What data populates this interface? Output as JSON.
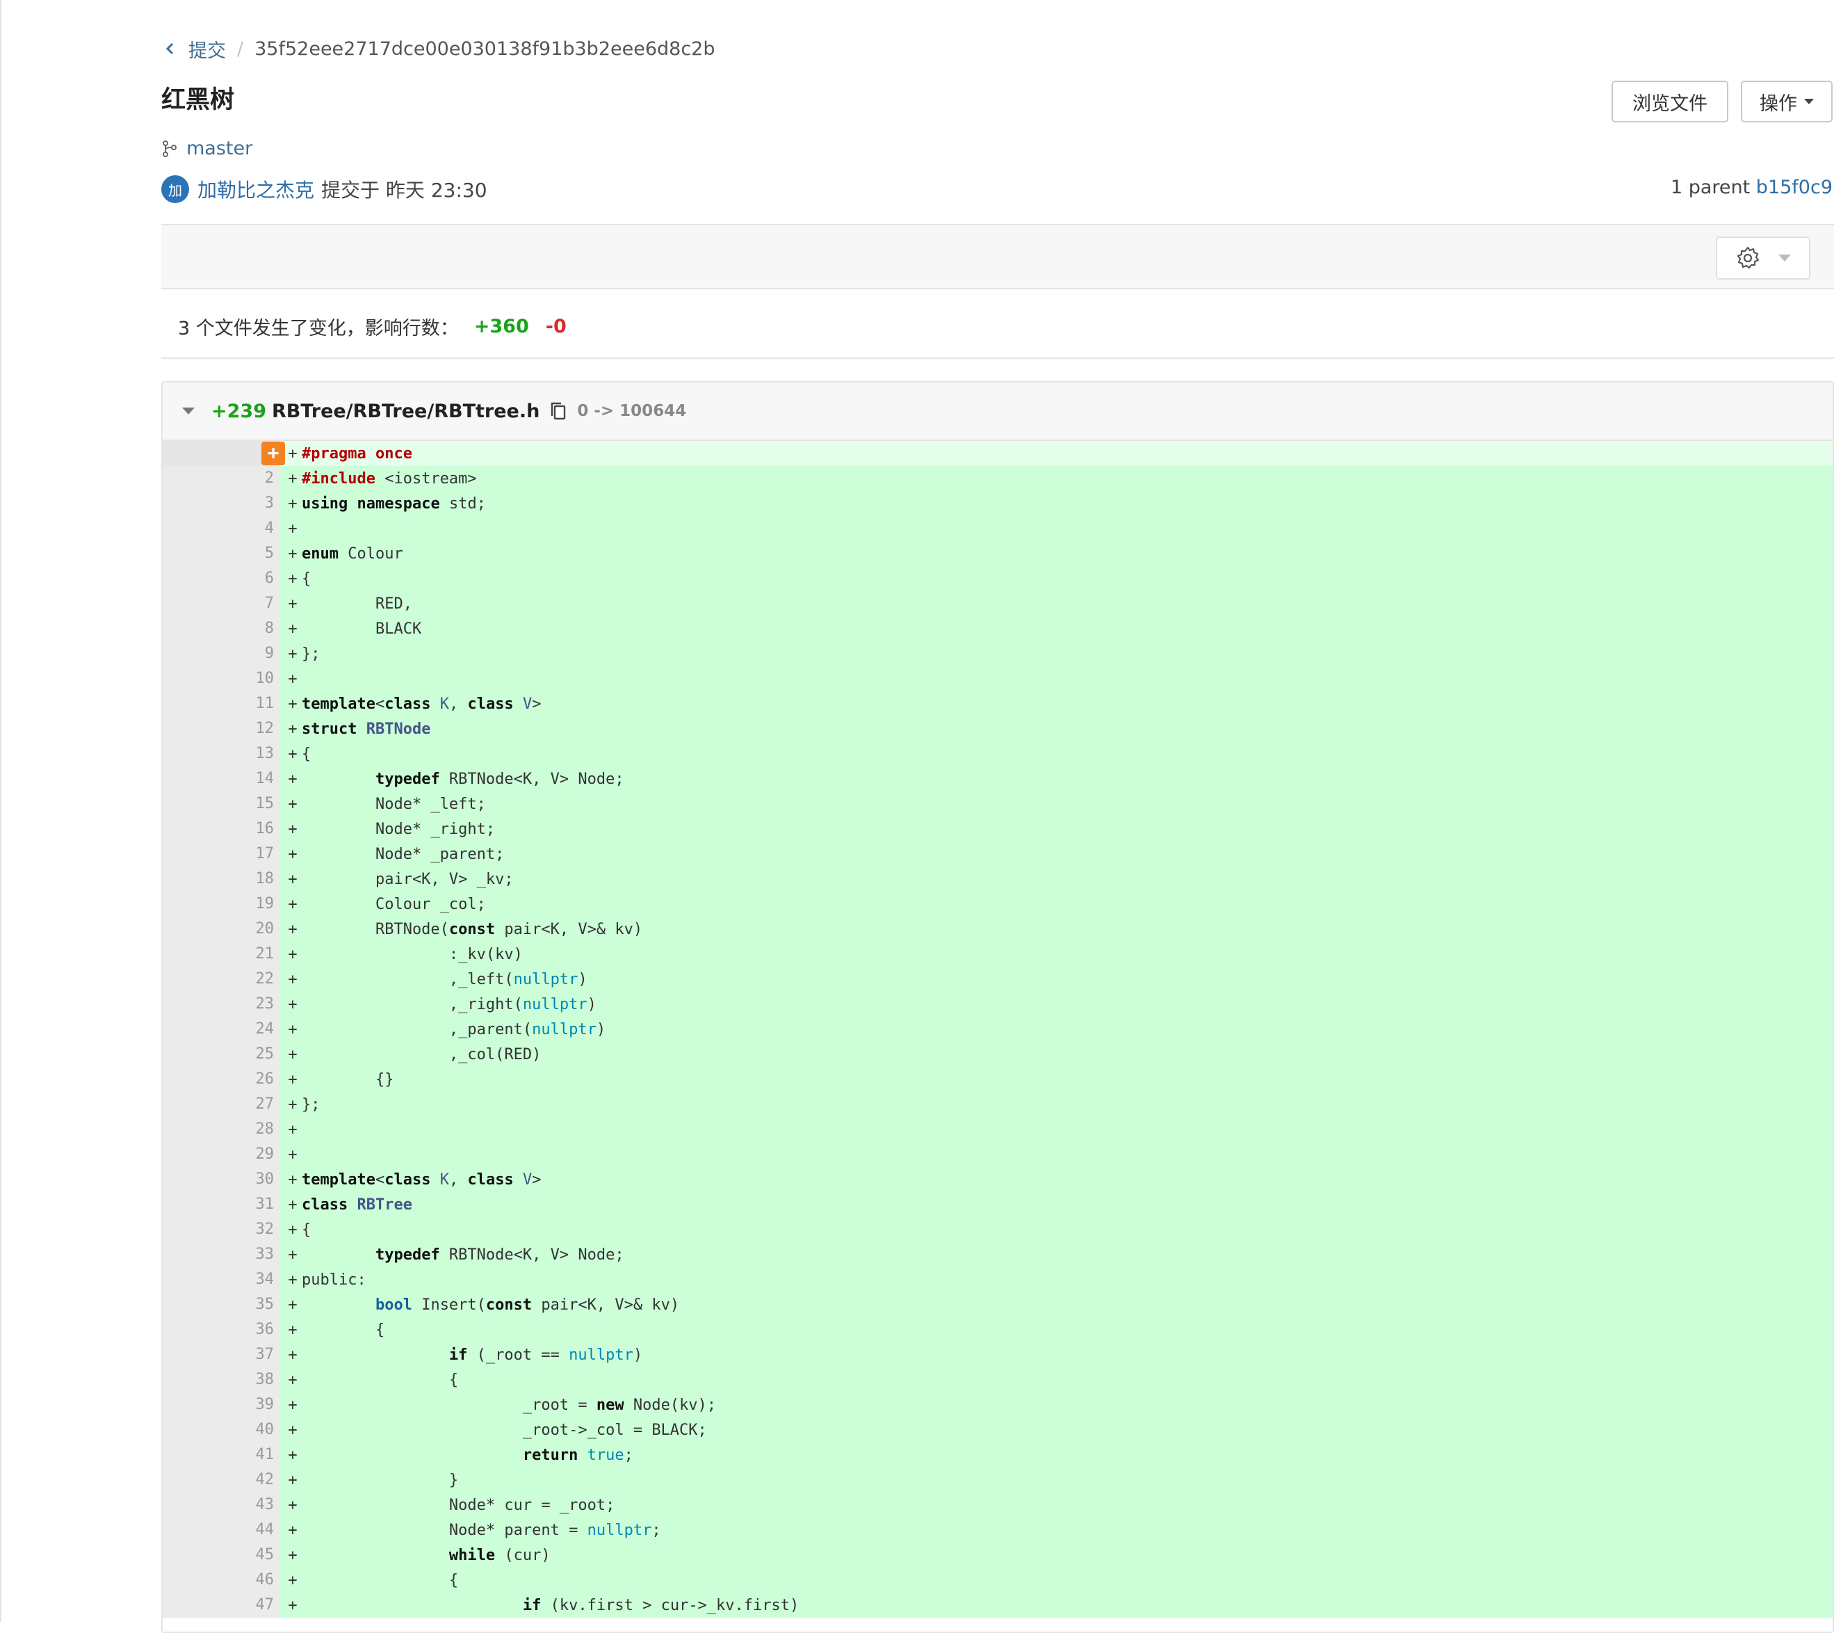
{
  "breadcrumb": {
    "back_label": "提交",
    "separator": "/",
    "commit_hash": "35f52eee2717dce00e030138f91b3b2eee6d8c2b"
  },
  "commit": {
    "title": "红黑树",
    "branch": "master",
    "author_avatar": "加",
    "author": "加勒比之杰克",
    "committed_text": "提交于 昨天 23:30",
    "parent_label": "1 parent",
    "parent_hash": "b15f0c9"
  },
  "actions": {
    "browse_label": "浏览文件",
    "ops_label": "操作"
  },
  "stats": {
    "summary": "3 个文件发生了变化，影响行数：",
    "additions": "+360",
    "deletions": "-0"
  },
  "file": {
    "additions": "+239",
    "path": "RBTree/RBTree/RBTtree.h",
    "mode_change": "0 -> 100644"
  },
  "icons": {
    "back": "chevron-left-icon",
    "branch": "branch-icon",
    "copy": "copy-icon",
    "settings": "gear-icon",
    "add_comment": "plus-icon"
  },
  "colors": {
    "added_bg": "#ccffd8",
    "added_count": "#1aa31a",
    "deleted_count": "#d62b2b",
    "link": "#2e6ea6",
    "comment_button": "#f58220"
  },
  "lines": [
    {
      "n": "1",
      "code": [
        {
          "t": "#pragma once",
          "c": "kw-red"
        }
      ]
    },
    {
      "n": "2",
      "code": [
        {
          "t": "#include",
          "c": "kw-red"
        },
        {
          "t": " <iostream>"
        }
      ]
    },
    {
      "n": "3",
      "code": [
        {
          "t": "using",
          "c": "kw"
        },
        {
          "t": " "
        },
        {
          "t": "namespace",
          "c": "kw"
        },
        {
          "t": " std;"
        }
      ]
    },
    {
      "n": "4",
      "code": []
    },
    {
      "n": "5",
      "code": [
        {
          "t": "enum",
          "c": "kw"
        },
        {
          "t": " Colour"
        }
      ]
    },
    {
      "n": "6",
      "code": [
        {
          "t": "{"
        }
      ]
    },
    {
      "n": "7",
      "code": [
        {
          "t": "        RED,"
        }
      ]
    },
    {
      "n": "8",
      "code": [
        {
          "t": "        BLACK"
        }
      ]
    },
    {
      "n": "9",
      "code": [
        {
          "t": "};"
        }
      ]
    },
    {
      "n": "10",
      "code": []
    },
    {
      "n": "11",
      "code": [
        {
          "t": "template",
          "c": "kw"
        },
        {
          "t": "<"
        },
        {
          "t": "class",
          "c": "kw"
        },
        {
          "t": " "
        },
        {
          "t": "K",
          "c": "tpl"
        },
        {
          "t": ", "
        },
        {
          "t": "class",
          "c": "kw"
        },
        {
          "t": " "
        },
        {
          "t": "V",
          "c": "tpl"
        },
        {
          "t": ">"
        }
      ]
    },
    {
      "n": "12",
      "code": [
        {
          "t": "struct",
          "c": "kw"
        },
        {
          "t": " "
        },
        {
          "t": "RBTNode",
          "c": "ty"
        }
      ]
    },
    {
      "n": "13",
      "code": [
        {
          "t": "{"
        }
      ]
    },
    {
      "n": "14",
      "code": [
        {
          "t": "        "
        },
        {
          "t": "typedef",
          "c": "kw"
        },
        {
          "t": " RBTNode<K, V> Node;"
        }
      ]
    },
    {
      "n": "15",
      "code": [
        {
          "t": "        Node* _left;"
        }
      ]
    },
    {
      "n": "16",
      "code": [
        {
          "t": "        Node* _right;"
        }
      ]
    },
    {
      "n": "17",
      "code": [
        {
          "t": "        Node* _parent;"
        }
      ]
    },
    {
      "n": "18",
      "code": [
        {
          "t": "        pair<K, V> _kv;"
        }
      ]
    },
    {
      "n": "19",
      "code": [
        {
          "t": "        Colour _col;"
        }
      ]
    },
    {
      "n": "20",
      "code": [
        {
          "t": "        RBTNode("
        },
        {
          "t": "const",
          "c": "kw"
        },
        {
          "t": " pair<K, V>& kv)"
        }
      ]
    },
    {
      "n": "21",
      "code": [
        {
          "t": "                :_kv(kv)"
        }
      ]
    },
    {
      "n": "22",
      "code": [
        {
          "t": "                ,_left("
        },
        {
          "t": "nullptr",
          "c": "lit"
        },
        {
          "t": ")"
        }
      ]
    },
    {
      "n": "23",
      "code": [
        {
          "t": "                ,_right("
        },
        {
          "t": "nullptr",
          "c": "lit"
        },
        {
          "t": ")"
        }
      ]
    },
    {
      "n": "24",
      "code": [
        {
          "t": "                ,_parent("
        },
        {
          "t": "nullptr",
          "c": "lit"
        },
        {
          "t": ")"
        }
      ]
    },
    {
      "n": "25",
      "code": [
        {
          "t": "                ,_col(RED)"
        }
      ]
    },
    {
      "n": "26",
      "code": [
        {
          "t": "        {}"
        }
      ]
    },
    {
      "n": "27",
      "code": [
        {
          "t": "};"
        }
      ]
    },
    {
      "n": "28",
      "code": []
    },
    {
      "n": "29",
      "code": []
    },
    {
      "n": "30",
      "code": [
        {
          "t": "template",
          "c": "kw"
        },
        {
          "t": "<"
        },
        {
          "t": "class",
          "c": "kw"
        },
        {
          "t": " "
        },
        {
          "t": "K",
          "c": "tpl"
        },
        {
          "t": ", "
        },
        {
          "t": "class",
          "c": "kw"
        },
        {
          "t": " "
        },
        {
          "t": "V",
          "c": "tpl"
        },
        {
          "t": ">"
        }
      ]
    },
    {
      "n": "31",
      "code": [
        {
          "t": "class",
          "c": "kw"
        },
        {
          "t": " "
        },
        {
          "t": "RBTree",
          "c": "ty"
        }
      ]
    },
    {
      "n": "32",
      "code": [
        {
          "t": "{"
        }
      ]
    },
    {
      "n": "33",
      "code": [
        {
          "t": "        "
        },
        {
          "t": "typedef",
          "c": "kw"
        },
        {
          "t": " RBTNode<K, V> Node;"
        }
      ]
    },
    {
      "n": "34",
      "code": [
        {
          "t": "public:"
        }
      ]
    },
    {
      "n": "35",
      "code": [
        {
          "t": "        "
        },
        {
          "t": "bool",
          "c": "kw-blue"
        },
        {
          "t": " Insert("
        },
        {
          "t": "const",
          "c": "kw"
        },
        {
          "t": " pair<K, V>& kv)"
        }
      ]
    },
    {
      "n": "36",
      "code": [
        {
          "t": "        {"
        }
      ]
    },
    {
      "n": "37",
      "code": [
        {
          "t": "                "
        },
        {
          "t": "if",
          "c": "kw"
        },
        {
          "t": " (_root == "
        },
        {
          "t": "nullptr",
          "c": "lit"
        },
        {
          "t": ")"
        }
      ]
    },
    {
      "n": "38",
      "code": [
        {
          "t": "                {"
        }
      ]
    },
    {
      "n": "39",
      "code": [
        {
          "t": "                        _root = "
        },
        {
          "t": "new",
          "c": "kw"
        },
        {
          "t": " Node(kv);"
        }
      ]
    },
    {
      "n": "40",
      "code": [
        {
          "t": "                        _root->_col = BLACK;"
        }
      ]
    },
    {
      "n": "41",
      "code": [
        {
          "t": "                        "
        },
        {
          "t": "return",
          "c": "kw"
        },
        {
          "t": " "
        },
        {
          "t": "true",
          "c": "bt"
        },
        {
          "t": ";"
        }
      ]
    },
    {
      "n": "42",
      "code": [
        {
          "t": "                }"
        }
      ]
    },
    {
      "n": "43",
      "code": [
        {
          "t": "                Node* cur = _root;"
        }
      ]
    },
    {
      "n": "44",
      "code": [
        {
          "t": "                Node* parent = "
        },
        {
          "t": "nullptr",
          "c": "lit"
        },
        {
          "t": ";"
        }
      ]
    },
    {
      "n": "45",
      "code": [
        {
          "t": "                "
        },
        {
          "t": "while",
          "c": "kw"
        },
        {
          "t": " (cur)"
        }
      ]
    },
    {
      "n": "46",
      "code": [
        {
          "t": "                {"
        }
      ]
    },
    {
      "n": "47",
      "code": [
        {
          "t": "                        "
        },
        {
          "t": "if",
          "c": "kw"
        },
        {
          "t": " (kv.first > cur->_kv.first)"
        }
      ]
    }
  ]
}
